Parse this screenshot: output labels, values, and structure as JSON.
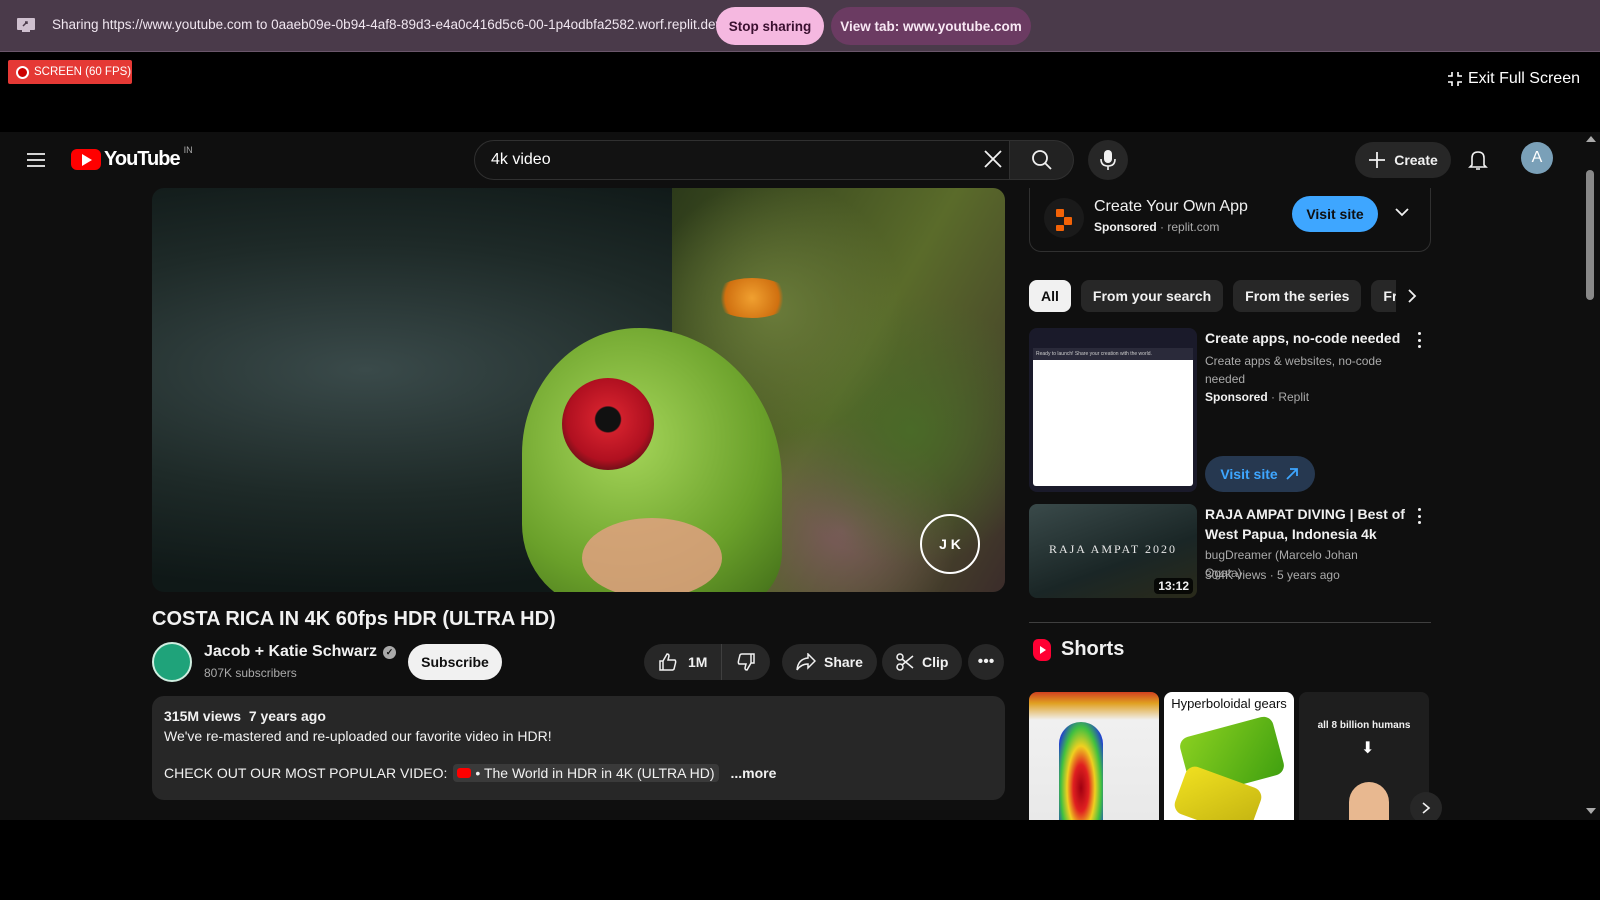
{
  "share_bar": {
    "text": "Sharing https://www.youtube.com to 0aaeb09e-0b94-4af8-89d3-e4a0c416d5c6-00-1p4odbfa2582.worf.replit.dev",
    "stop_label": "Stop sharing",
    "view_tab_label": "View tab: www.youtube.com"
  },
  "recording": {
    "badge": "SCREEN (60 FPS)",
    "exit_label": "Exit Full Screen"
  },
  "header": {
    "logo_text": "YouTube",
    "country_code": "IN",
    "search_value": "4k video",
    "create_label": "Create",
    "avatar_initial": "A"
  },
  "video": {
    "title": "COSTA RICA IN 4K 60fps HDR (ULTRA HD)",
    "channel_name": "Jacob + Katie Schwarz",
    "subscribers": "807K subscribers",
    "subscribe_label": "Subscribe",
    "likes": "1M",
    "share_label": "Share",
    "clip_label": "Clip",
    "watermark": "J K",
    "description": {
      "views": "315M views",
      "age": "7 years ago",
      "line1": "We've re-mastered and re-uploaded our favorite video in HDR!",
      "line2_prefix": "CHECK OUT OUR MOST POPULAR VIDEO:",
      "linked_video": "• The World in HDR in 4K (ULTRA HD)",
      "more": "...more"
    }
  },
  "sidebar": {
    "ad": {
      "title": "Create Your Own App",
      "sponsored": "Sponsored",
      "domain": "replit.com",
      "visit_label": "Visit site"
    },
    "chips": [
      "All",
      "From your search",
      "From the series",
      "Fro"
    ],
    "recommendations": [
      {
        "title": "Create apps, no-code needed",
        "subtitle": "Create apps & websites, no-code needed",
        "sponsored": "Sponsored",
        "advertiser": "Replit",
        "visit_label": "Visit site",
        "thumb_text": "Ready to launch! Share your creation with the world."
      },
      {
        "title": "RAJA AMPAT DIVING | Best of West Papua, Indonesia 4k",
        "channel": "bugDreamer (Marcelo Johan Ogata)",
        "views": "304K views",
        "age": "5 years ago",
        "duration": "13:12",
        "thumb_text": "RAJA AMPAT 2020"
      }
    ],
    "shorts": {
      "heading": "Shorts",
      "items": [
        {
          "title": ""
        },
        {
          "title": "Hyperboloidal gears"
        },
        {
          "title": "all 8 billion humans"
        }
      ]
    }
  },
  "colors": {
    "share_bar_bg": "#4a3a4a",
    "stop_button": "#f5b8e0",
    "view_tab_button": "#6b3b62",
    "record_badge": "#e53935",
    "youtube_red": "#ff0000",
    "visit_blue": "#3ea6ff",
    "page_bg": "#0f0f0f"
  }
}
